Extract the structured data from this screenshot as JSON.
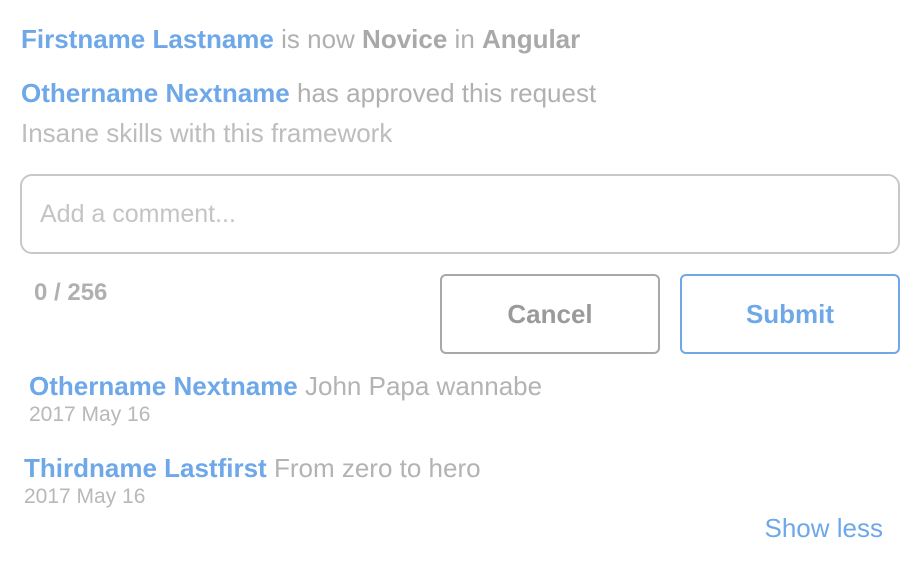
{
  "status": {
    "user": "Firstname Lastname",
    "text_is_now": "is now",
    "level": "Novice",
    "text_in": "in",
    "skill": "Angular"
  },
  "approval": {
    "approver": "Othername Nextname",
    "text": "has approved this request",
    "note": "Insane skills with this framework"
  },
  "comment_form": {
    "placeholder": "Add a comment...",
    "value": "",
    "counter": "0 / 256",
    "cancel_label": "Cancel",
    "submit_label": "Submit"
  },
  "comments": [
    {
      "author": "Othername Nextname",
      "text": "John Papa wannabe",
      "date": "2017 May 16"
    },
    {
      "author": "Thirdname Lastfirst",
      "text": "From zero to hero",
      "date": "2017 May 16"
    }
  ],
  "show_less_label": "Show less",
  "colors": {
    "accent": "#6ea8e8",
    "muted": "#b0b0b0"
  }
}
